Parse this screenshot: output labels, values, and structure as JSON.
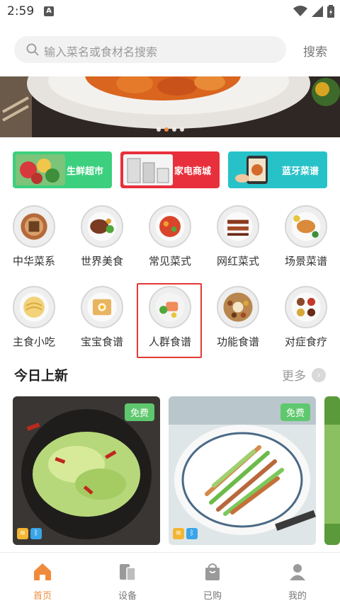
{
  "status": {
    "time": "2:59",
    "notification_letter": "A"
  },
  "search": {
    "placeholder": "输入菜名或食材名搜索",
    "button_label": "搜索"
  },
  "promo_cards": [
    {
      "label": "生鲜超市",
      "color": "#3ccf7e"
    },
    {
      "label": "家电商城",
      "color": "#e8303c"
    },
    {
      "label": "蓝牙菜谱",
      "color": "#27c2c8"
    }
  ],
  "categories_row1": [
    {
      "label": "中华菜系"
    },
    {
      "label": "世界美食"
    },
    {
      "label": "常见菜式"
    },
    {
      "label": "网红菜式"
    },
    {
      "label": "场景菜谱"
    }
  ],
  "categories_row2": [
    {
      "label": "主食小吃"
    },
    {
      "label": "宝宝食谱"
    },
    {
      "label": "人群食谱"
    },
    {
      "label": "功能食谱"
    },
    {
      "label": "对症食疗"
    }
  ],
  "section": {
    "title": "今日上新",
    "more_label": "更多"
  },
  "recipes": [
    {
      "badge": "免费"
    },
    {
      "badge": "免费"
    }
  ],
  "tabbar": [
    {
      "label": "首页",
      "active": true
    },
    {
      "label": "设备",
      "active": false
    },
    {
      "label": "已购",
      "active": false
    },
    {
      "label": "我的",
      "active": false
    }
  ],
  "colors": {
    "accent": "#f08b3c",
    "free_badge": "#5fc86e",
    "selection": "#e53935"
  }
}
